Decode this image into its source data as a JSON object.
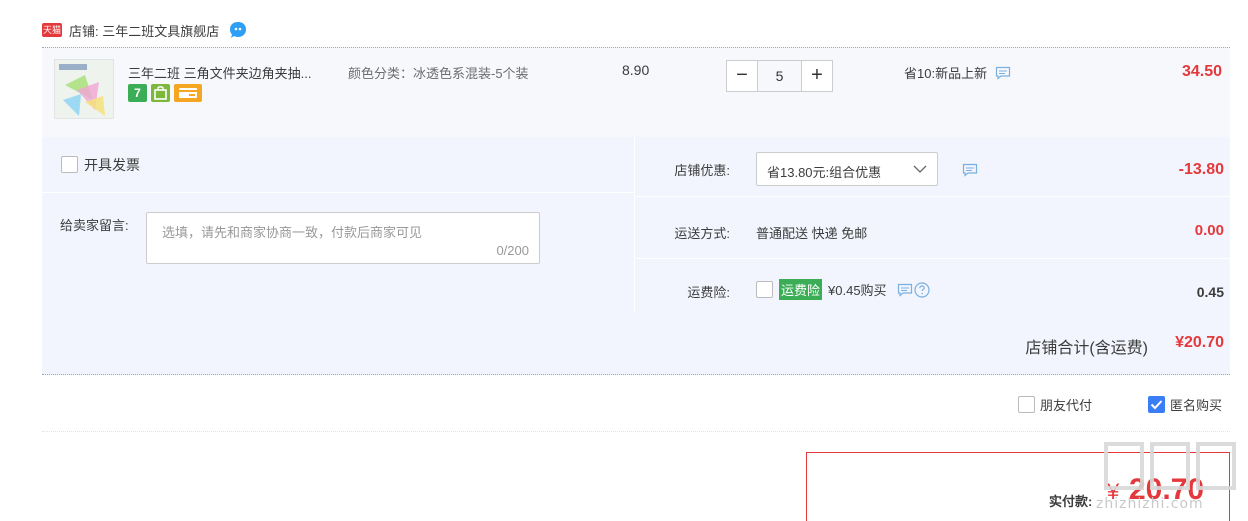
{
  "shop": {
    "badge_text": "天猫",
    "label": "店铺: 三年二班文具旗舰店",
    "icons": [
      "tmall-icon",
      "wangwang-chat-icon"
    ]
  },
  "item": {
    "title": "三年二班 三角文件夹边角夹抽...",
    "sku": "颜色分类：冰透色系混装-5个装",
    "badges": [
      "7",
      "",
      ""
    ],
    "unit_price": "8.90",
    "quantity": "5",
    "minus_label": "−",
    "plus_label": "+",
    "promo": "省10:新品上新",
    "total": "34.50"
  },
  "options": {
    "invoice_label": "开具发票",
    "memo_label": "给卖家留言:",
    "memo_placeholder": "选填，请先和商家协商一致，付款后商家可见",
    "memo_count": "0/200",
    "discount": {
      "label": "店铺优惠:",
      "selected": "省13.80元:组合优惠",
      "amount": "-13.80"
    },
    "shipping": {
      "label": "运送方式:",
      "value": "普通配送 快递 免邮",
      "amount": "0.00"
    },
    "insurance": {
      "label": "运费险:",
      "tag": "运费险",
      "price": "¥0.45购买",
      "amount": "0.45"
    }
  },
  "summary": {
    "label": "店铺合计(含运费)",
    "value": "¥20.70"
  },
  "extras": {
    "friend_pay": "朋友代付",
    "anonymous": "匿名购买",
    "anonymous_checked": true
  },
  "payment": {
    "label": "实付款:",
    "yen": "¥",
    "value": "20.70"
  },
  "watermark": {
    "text": "zhizhizhi.com"
  },
  "colors": {
    "price_red": "#e4393c",
    "panel_bg": "#f2f5fd",
    "badge_green": "#3cad57",
    "checkbox_blue": "#3a7ef5"
  }
}
